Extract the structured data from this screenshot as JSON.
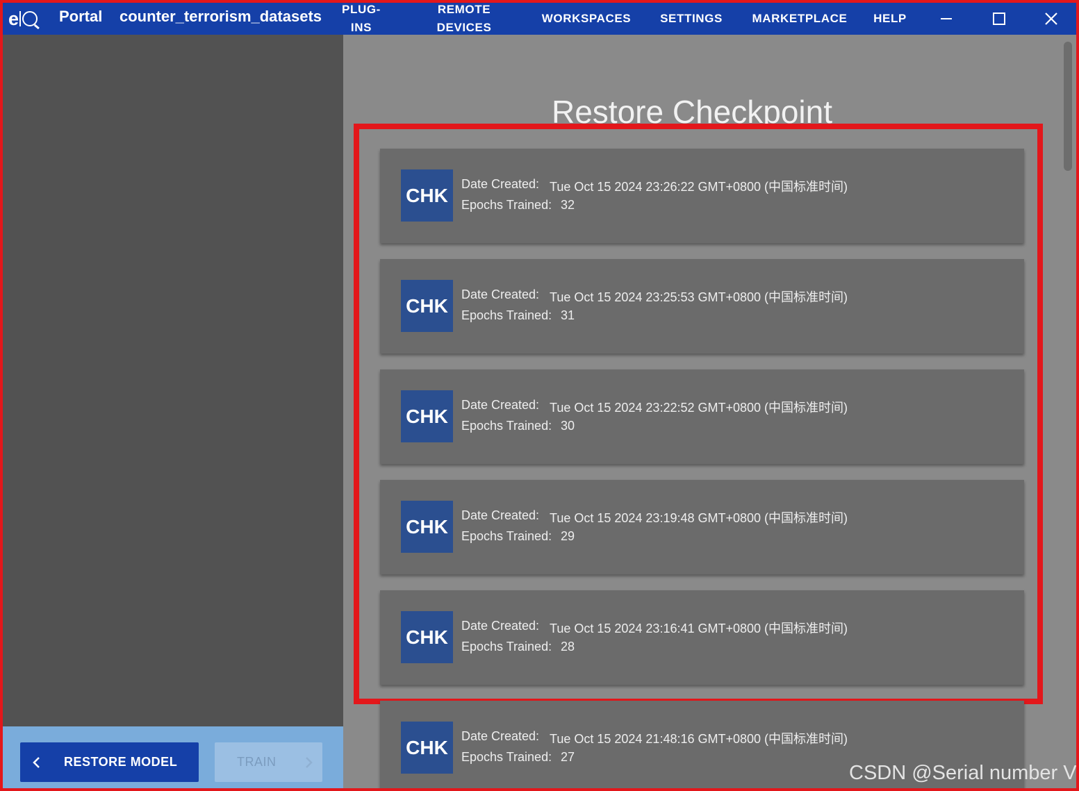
{
  "app": {
    "logo_text": "e|Q",
    "title": "Portal",
    "project": "counter_terrorism_datasets"
  },
  "nav": {
    "plugins_line1": "PLUG-",
    "plugins_line2": "INS",
    "remote_line1": "REMOTE",
    "remote_line2": "DEVICES",
    "workspaces": "WORKSPACES",
    "settings": "SETTINGS",
    "marketplace": "MARKETPLACE",
    "help": "HELP"
  },
  "window_controls": [
    "minimize-icon",
    "maximize-icon",
    "close-icon"
  ],
  "main": {
    "title": "Restore Checkpoint",
    "date_label": "Date Created:",
    "epochs_label": "Epochs Trained:",
    "checkpoints": [
      {
        "badge": "CHK",
        "date": "Tue Oct 15 2024 23:26:22 GMT+0800 (中国标准时间)",
        "epochs": "32"
      },
      {
        "badge": "CHK",
        "date": "Tue Oct 15 2024 23:25:53 GMT+0800 (中国标准时间)",
        "epochs": "31"
      },
      {
        "badge": "CHK",
        "date": "Tue Oct 15 2024 23:22:52 GMT+0800 (中国标准时间)",
        "epochs": "30"
      },
      {
        "badge": "CHK",
        "date": "Tue Oct 15 2024 23:19:48 GMT+0800 (中国标准时间)",
        "epochs": "29"
      },
      {
        "badge": "CHK",
        "date": "Tue Oct 15 2024 23:16:41 GMT+0800 (中国标准时间)",
        "epochs": "28"
      },
      {
        "badge": "CHK",
        "date": "Tue Oct 15 2024 21:48:16 GMT+0800 (中国标准时间)",
        "epochs": "27"
      }
    ]
  },
  "sidebar": {
    "restore_model_label": "RESTORE MODEL",
    "train_label": "TRAIN"
  },
  "colors": {
    "titlebar": "#1540a8",
    "highlight": "#e3171b",
    "badge": "#2b4f90",
    "footer": "#7aacdb"
  },
  "watermark": "CSDN @Serial number V"
}
